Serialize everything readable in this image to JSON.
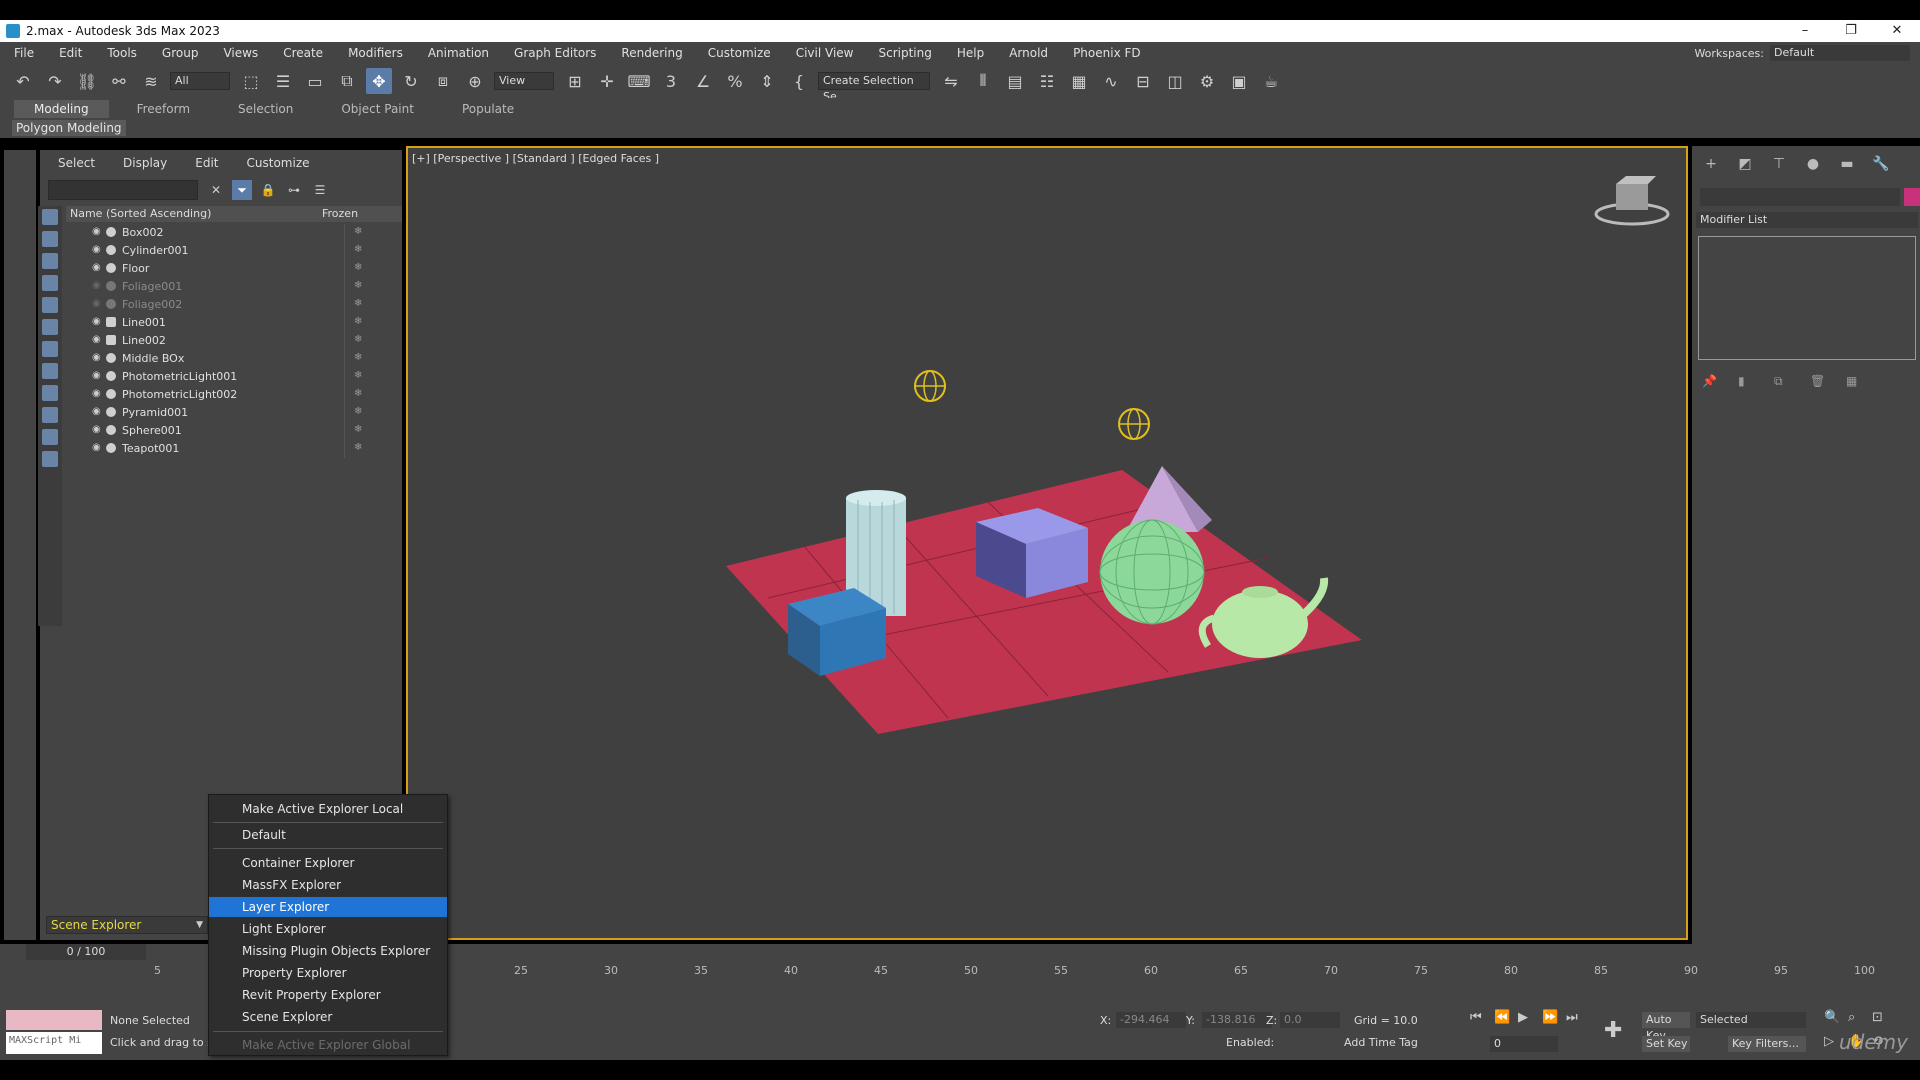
{
  "window": {
    "title": "2.max - Autodesk 3ds Max 2023",
    "minimize": "–",
    "maximize": "❐",
    "close": "✕"
  },
  "menu": [
    "File",
    "Edit",
    "Tools",
    "Group",
    "Views",
    "Create",
    "Modifiers",
    "Animation",
    "Graph Editors",
    "Rendering",
    "Customize",
    "Civil View",
    "Scripting",
    "Help",
    "Arnold",
    "Phoenix FD"
  ],
  "workspaces": {
    "label": "Workspaces:",
    "value": "Default"
  },
  "toolbar": {
    "filter": "All",
    "view": "View",
    "selection_set": "Create Selection Se"
  },
  "ribbon": {
    "tabs": [
      "Modeling",
      "Freeform",
      "Selection",
      "Object Paint",
      "Populate"
    ],
    "active": "Modeling",
    "panel": "Polygon Modeling"
  },
  "explorer": {
    "menu": [
      "Select",
      "Display",
      "Edit",
      "Customize"
    ],
    "header_name": "Name (Sorted Ascending)",
    "header_frozen": "Frozen",
    "objects": [
      {
        "name": "Box002",
        "dim": false
      },
      {
        "name": "Cylinder001",
        "dim": false
      },
      {
        "name": "Floor",
        "dim": false
      },
      {
        "name": "Foliage001",
        "dim": true
      },
      {
        "name": "Foliage002",
        "dim": true
      },
      {
        "name": "Line001",
        "dim": false
      },
      {
        "name": "Line002",
        "dim": false
      },
      {
        "name": "Middle BOx",
        "dim": false
      },
      {
        "name": "PhotometricLight001",
        "dim": false
      },
      {
        "name": "PhotometricLight002",
        "dim": false
      },
      {
        "name": "Pyramid001",
        "dim": false
      },
      {
        "name": "Sphere001",
        "dim": false
      },
      {
        "name": "Teapot001",
        "dim": false
      }
    ],
    "dropdown": "Scene Explorer"
  },
  "viewport": {
    "label": "[+] [Perspective ] [Standard ] [Edged Faces ]"
  },
  "context_menu": {
    "items": [
      {
        "label": "Make Active Explorer Local",
        "state": "normal"
      },
      {
        "label": "Default",
        "state": "normal"
      },
      {
        "label": "Container Explorer",
        "state": "normal"
      },
      {
        "label": "MassFX Explorer",
        "state": "normal"
      },
      {
        "label": "Layer Explorer",
        "state": "highlight"
      },
      {
        "label": "Light Explorer",
        "state": "normal"
      },
      {
        "label": "Missing Plugin Objects Explorer",
        "state": "normal"
      },
      {
        "label": "Property Explorer",
        "state": "normal"
      },
      {
        "label": "Revit Property Explorer",
        "state": "normal"
      },
      {
        "label": "Scene Explorer",
        "state": "normal"
      },
      {
        "label": "Make Active Explorer Global",
        "state": "disabled"
      }
    ]
  },
  "command_panel": {
    "modifier_list": "Modifier List"
  },
  "timeline": {
    "frame": "0 / 100",
    "ticks": [
      "5",
      "25",
      "30",
      "35",
      "40",
      "45",
      "50",
      "55",
      "60",
      "65",
      "70",
      "75",
      "80",
      "85",
      "90",
      "95",
      "100"
    ]
  },
  "status": {
    "maxscript": "MAXScript Mi",
    "selected": "None Selected",
    "prompt": "Click and drag to se",
    "x_label": "X:",
    "x": "-294.464",
    "y_label": "Y:",
    "y": "-138.816",
    "z_label": "Z:",
    "z": "0.0",
    "grid": "Grid = 10.0",
    "enabled": "Enabled:",
    "add_time_tag": "Add Time Tag",
    "auto_key": "Auto Key",
    "set_key": "Set Key",
    "key_mode": "Selected",
    "key_filters": "Key Filters...",
    "frame_value": "0",
    "watermark": "udemy"
  },
  "colors": {
    "accent": "#1f74d6",
    "viewport_border": "#d4a017",
    "floor": "#c0344f"
  }
}
